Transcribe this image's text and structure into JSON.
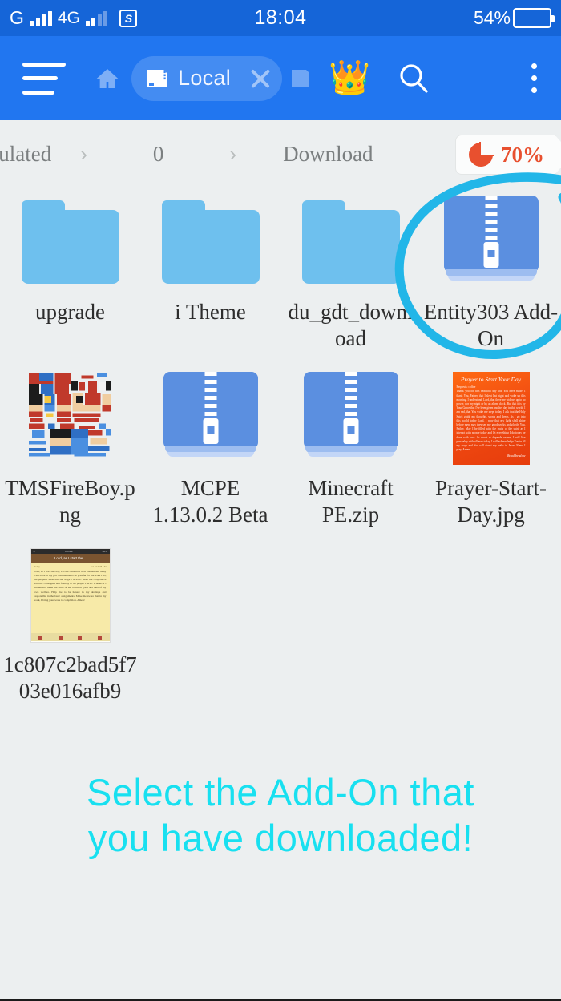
{
  "statusbar": {
    "network_type": "G",
    "network_type_2": "4G",
    "app_icon_letter": "S",
    "time": "18:04",
    "battery_percent": "54%"
  },
  "toolbar": {
    "menu_icon": "hamburger-icon",
    "home_icon": "home-icon",
    "tab_label": "Local",
    "tab_icon": "sdcard-icon",
    "tab_close_icon": "close-icon",
    "premium_icon": "crown-icon",
    "search_icon": "search-icon",
    "overflow_icon": "more-vertical-icon"
  },
  "breadcrumb": {
    "items": [
      "...ulated",
      "0",
      "Download"
    ],
    "separator": "›",
    "storage_percent": "70%",
    "storage_icon": "pie-chart-icon",
    "storage_color": "#e8502f"
  },
  "files": [
    {
      "name": "upgrade",
      "type": "folder"
    },
    {
      "name": "i Theme",
      "type": "folder"
    },
    {
      "name": "du_gdt_download",
      "type": "folder"
    },
    {
      "name": "Entity303 Add-On",
      "type": "zip",
      "selected": true
    },
    {
      "name": "TMSFireBoy.png",
      "type": "image-skin"
    },
    {
      "name": "MCPE 1.13.0.2 Beta",
      "type": "zip"
    },
    {
      "name": "Minecraft PE.zip",
      "type": "zip"
    },
    {
      "name": "Prayer-Start-Day.jpg",
      "type": "image-prayer"
    },
    {
      "name": "1c807c2bad5f703e016afb9",
      "type": "image-note"
    }
  ],
  "thumbnails": {
    "prayer": {
      "title": "Prayer to Start Your Day",
      "subtitle": "Requests:  coffee",
      "body": "Thank you for this beautiful day that You have made. I thank You, Father, that I slept last night and woke up this morning. I understand, Lord, that there are widows up to no power, nor my night or by an alarm clock. But that it is by Your Grace that I've been given another day in this world. I am sad, that You woke me steps today. I ask that the Holy Spirit guide my thoughts, words and deeds. As I go into this world today Lord, I pray that my light shall shine before men, may they see my good works and glorify You, Father. May I be filled with the fruits of the spirit as I interact with people today and let everything I do today be done with love. As much as depends on me, I will live peaceably with all men today. I will acknowledge You in all my ways and You will direct my paths in Jesus' Name I pray, Amen.",
      "signature": "BreadBread.me"
    },
    "note": {
      "status_left": "....",
      "status_time": "9:43 AM",
      "status_right": "100%",
      "title": "Lord, as I start the...",
      "date_left": "Today",
      "date_right": "Jun 10  9:38 AM",
      "body": "Lord, as I start this day, Let me remember how blessed and lucky I am to be in my job. Remind me to be grateful for the work I do, the people I meet and the wage I receive. Keep me cooperative with my colleagues and friendly to the people I serve. Whenever I am unsure, make me think of the common good and later of my own welfare. Help me to be honest in my dealings and responsible in the basic assignments. Make me aware that in my work, I bring your work to completion. Amen!"
    }
  },
  "annotations": {
    "circle_target": "Entity303 Add-On",
    "circle_color": "#22b6e8",
    "text_line_1": "Select the Add-On that",
    "text_line_2": "you have downloaded!",
    "text_color": "#18e0f0"
  }
}
